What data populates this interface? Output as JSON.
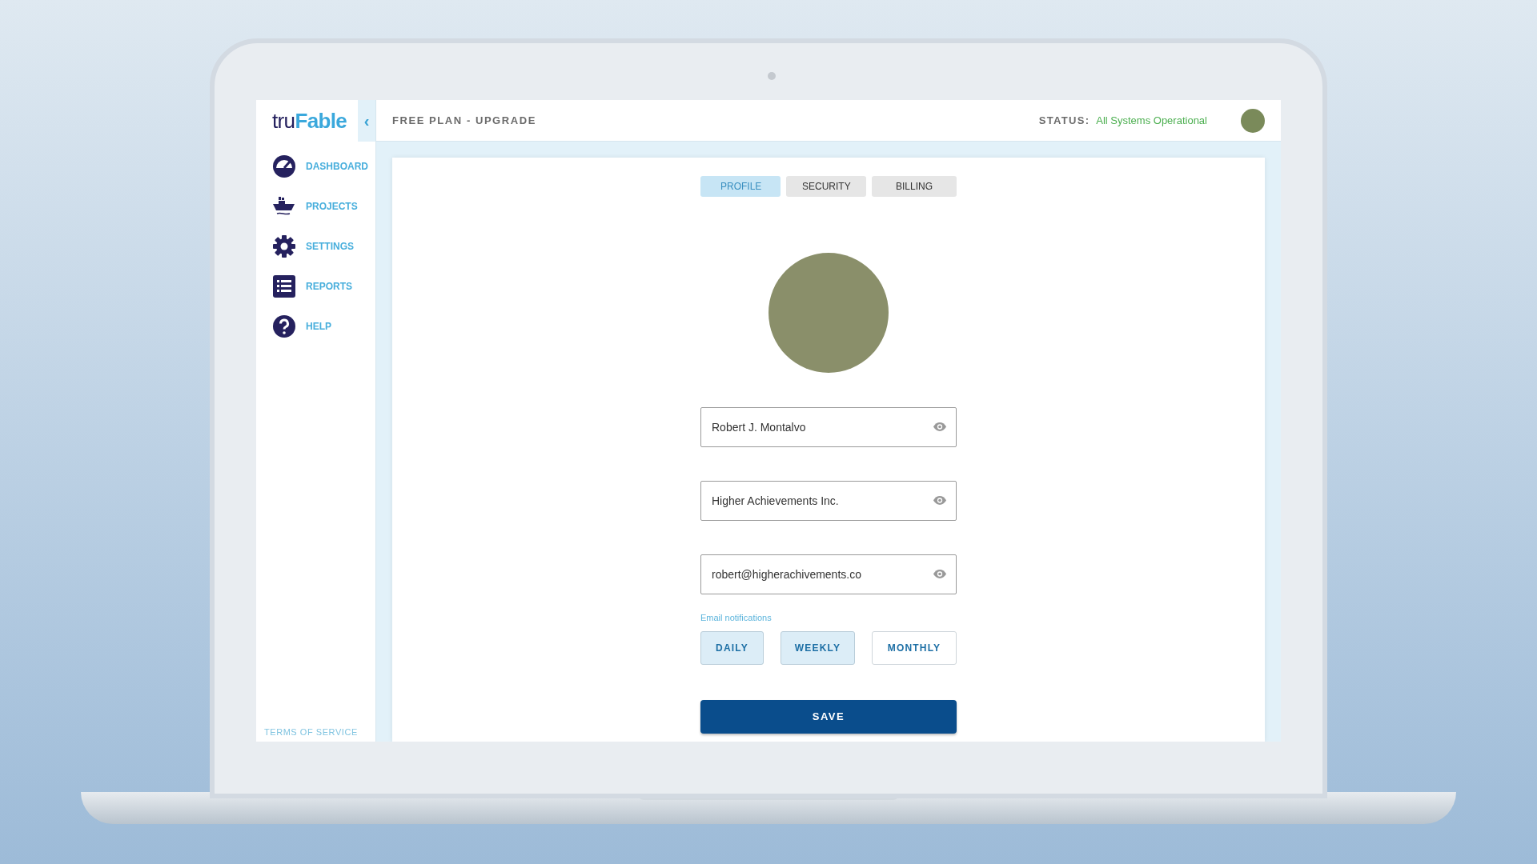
{
  "logo": {
    "part_1": "tru",
    "part_2": "Fable"
  },
  "sidebar": {
    "collapse": "‹",
    "items": [
      {
        "label": "DASHBOARD",
        "kind": "gauge"
      },
      {
        "label": "PROJECTS",
        "kind": "ship"
      },
      {
        "label": "SETTINGS",
        "kind": "gear"
      },
      {
        "label": "REPORTS",
        "kind": "list"
      },
      {
        "label": "HELP",
        "kind": "help"
      }
    ],
    "footer": "TERMS OF SERVICE"
  },
  "top_bar": {
    "plan": "FREE PLAN - UPGRADE",
    "status_label": "STATUS:",
    "status_value": "All Systems Operational"
  },
  "tabs": [
    {
      "label": "PROFILE",
      "selected": true
    },
    {
      "label": "SECURITY",
      "selected": false
    },
    {
      "label": "BILLING",
      "selected": false
    }
  ],
  "fields": [
    {
      "value": "Robert J. Montalvo"
    },
    {
      "value": "Higher Achievements Inc."
    },
    {
      "value": "robert@higherachivements.co"
    }
  ],
  "email_notifications": {
    "label": "Email notifications",
    "options": [
      {
        "label": "DAILY",
        "selected": true
      },
      {
        "label": "WEEKLY",
        "selected": true
      },
      {
        "label": "MONTHLY",
        "selected": false
      }
    ]
  },
  "save_button": "SAVE"
}
